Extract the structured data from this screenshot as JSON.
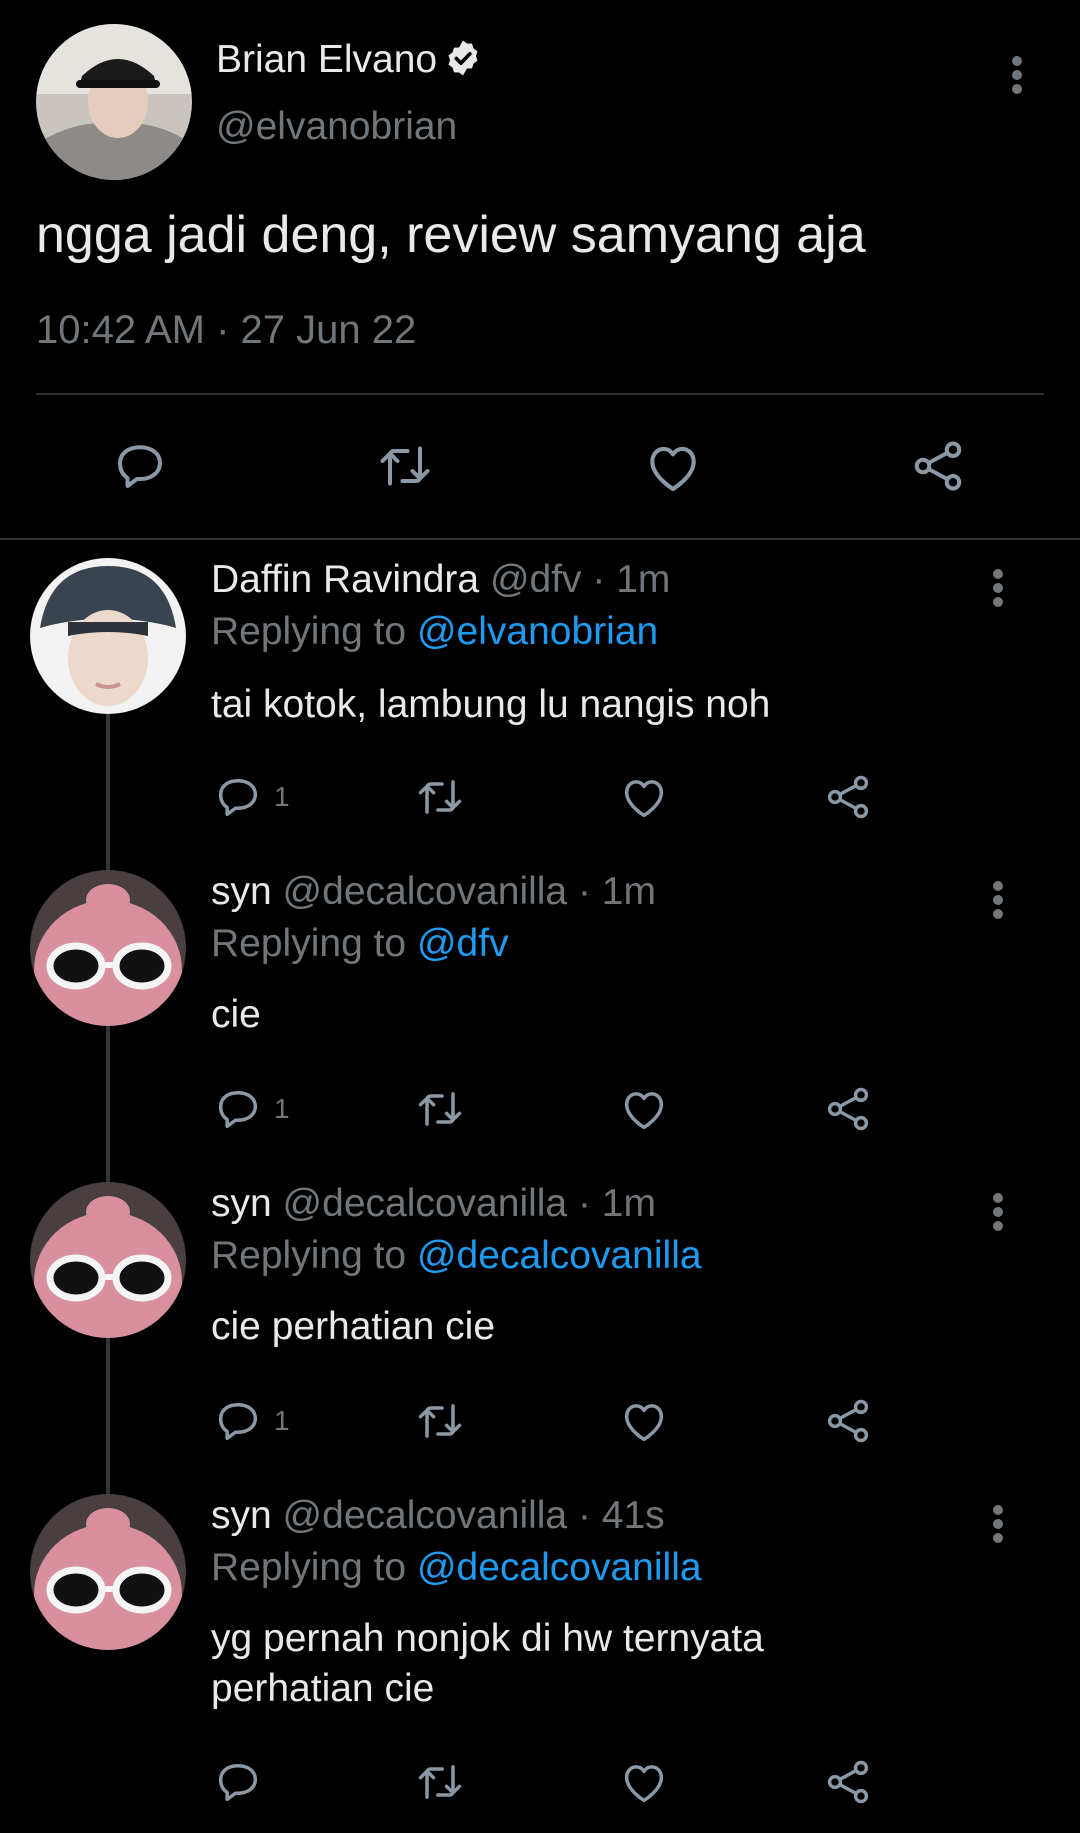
{
  "main_tweet": {
    "display_name": "Brian Elvano",
    "handle": "@elvanobrian",
    "text": "ngga jadi deng, review samyang aja",
    "timestamp": "10:42 AM · 27 Jun 22"
  },
  "replies": [
    {
      "display_name": "Daffin Ravindra",
      "handle": "@dfv",
      "time": "· 1m",
      "replying_label": "Replying to",
      "replying_to": "@elvanobrian",
      "text": "tai kotok, lambung lu nangis noh",
      "reply_count": "1"
    },
    {
      "display_name": "syn",
      "handle": "@decalcovanilla",
      "time": "· 1m",
      "replying_label": "Replying to",
      "replying_to": "@dfv",
      "text": "cie",
      "reply_count": "1"
    },
    {
      "display_name": "syn",
      "handle": "@decalcovanilla",
      "time": "· 1m",
      "replying_label": "Replying to",
      "replying_to": "@decalcovanilla",
      "text": "cie perhatian cie",
      "reply_count": "1"
    },
    {
      "display_name": "syn",
      "handle": "@decalcovanilla",
      "time": "· 41s",
      "replying_label": "Replying to",
      "replying_to": "@decalcovanilla",
      "text": "yg pernah nonjok di hw ternyata perhatian cie",
      "reply_count": ""
    }
  ],
  "icons": {
    "reply": "reply-icon",
    "retweet": "retweet-icon",
    "like": "like-icon",
    "share": "share-icon",
    "more": "more-vertical-icon",
    "verified": "verified-badge-icon"
  },
  "colors": {
    "background": "#000000",
    "text": "#e7e9ea",
    "secondary": "#71767b",
    "mention": "#1d9bf0",
    "divider": "#2f3336"
  }
}
